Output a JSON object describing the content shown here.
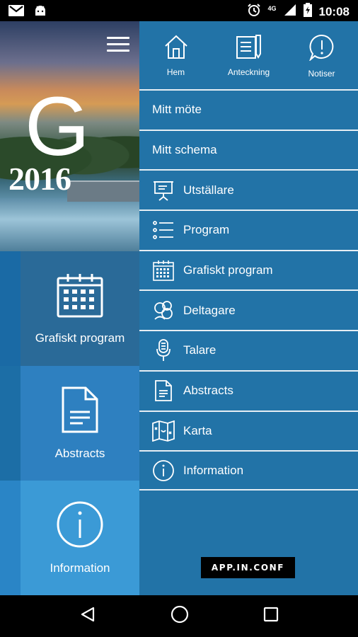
{
  "status_bar": {
    "time": "10:08",
    "network": "4G",
    "icons": [
      "gmail-icon",
      "android-icon",
      "alarm-icon",
      "signal-icon",
      "battery-charging-icon"
    ]
  },
  "hero": {
    "logo_fragment": "G",
    "year": "2016"
  },
  "left_tiles": [
    {
      "label": "Grafiskt program",
      "icon": "calendar-icon",
      "color": "#2a6a98"
    },
    {
      "label": "Abstracts",
      "icon": "document-icon",
      "color": "#2e80c0"
    },
    {
      "label": "Information",
      "icon": "info-icon",
      "color": "#3b9ad6"
    }
  ],
  "drawer": {
    "top_items": [
      {
        "label": "Hem",
        "icon": "home-icon"
      },
      {
        "label": "Anteckning",
        "icon": "note-icon"
      },
      {
        "label": "Notiser",
        "icon": "notification-icon"
      }
    ],
    "menu": [
      {
        "label": "Mitt möte",
        "icon": ""
      },
      {
        "label": "Mitt schema",
        "icon": ""
      },
      {
        "label": "Utställare",
        "icon": "presentation-icon"
      },
      {
        "label": "Program",
        "icon": "list-icon"
      },
      {
        "label": "Grafiskt program",
        "icon": "calendar-icon"
      },
      {
        "label": "Deltagare",
        "icon": "people-icon"
      },
      {
        "label": "Talare",
        "icon": "microphone-icon"
      },
      {
        "label": "Abstracts",
        "icon": "document-icon"
      },
      {
        "label": "Karta",
        "icon": "map-icon"
      },
      {
        "label": "Information",
        "icon": "info-icon"
      }
    ],
    "powered_by": "APP.IN.CONF"
  },
  "nav_bar": {
    "icons": [
      "back-icon",
      "home-circle-icon",
      "recents-icon"
    ]
  },
  "colors": {
    "drawer_bg": "#2273a7",
    "divider": "#e6eef4",
    "status_bg": "#000000"
  }
}
